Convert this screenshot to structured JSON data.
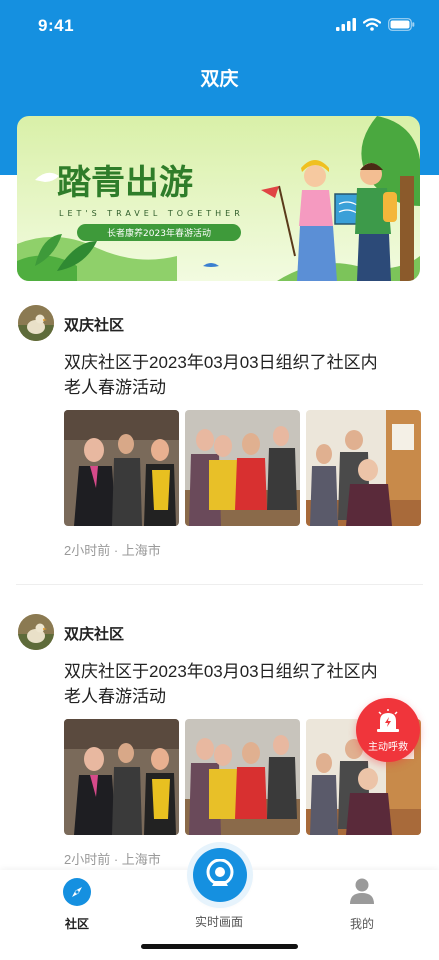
{
  "status_bar": {
    "time": "9:41"
  },
  "header": {
    "title": "双庆"
  },
  "banner": {
    "headline": "踏青出游",
    "subline": "LET'S TRAVEL TOGETHER",
    "tag": "长者康养2023年春游活动"
  },
  "posts": [
    {
      "author": "双庆社区",
      "content": "双庆社区于2023年03月03日组织了社区内老人春游活动",
      "meta": "2小时前 · 上海市"
    },
    {
      "author": "双庆社区",
      "content": "双庆社区于2023年03月03日组织了社区内老人春游活动",
      "meta": "2小时前 · 上海市"
    }
  ],
  "sos": {
    "label": "主动呼救"
  },
  "tabbar": {
    "items": [
      {
        "label": "社区",
        "icon": "compass-icon",
        "active": true
      },
      {
        "label": "实时画面",
        "icon": "camera-icon",
        "active": false
      },
      {
        "label": "我的",
        "icon": "user-icon",
        "active": false
      }
    ]
  },
  "colors": {
    "primary": "#1590e0",
    "sos": "#f0353b",
    "banner_green": "#3e9a3a"
  }
}
